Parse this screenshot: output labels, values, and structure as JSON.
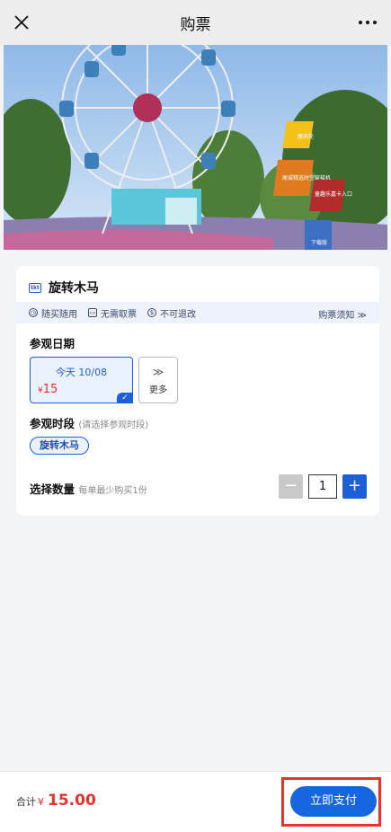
{
  "nav": {
    "title": "购票"
  },
  "banner": {
    "signs": [
      "摩天轮",
      "尾城精选时空穿梭机",
      "童趣乐嘉卡入口",
      "下载版"
    ]
  },
  "ticket": {
    "icon_text": "tkt",
    "name": "旋转木马"
  },
  "policies": [
    {
      "label": "随买随用"
    },
    {
      "label": "无需取票"
    },
    {
      "label": "不可退改"
    }
  ],
  "policy_notice": "购票须知 ≫",
  "visit_date": {
    "title": "参观日期",
    "selected": {
      "label": "今天 10/08",
      "currency": "¥",
      "price": "15"
    },
    "more_label": "更多",
    "more_chevron": "≫"
  },
  "visit_slot": {
    "title": "参观时段",
    "hint": "(请选择参观时段)",
    "chip": "旋转木马"
  },
  "quantity": {
    "title": "选择数量",
    "hint": "每单最少购买1份",
    "value": "1",
    "minus": "−",
    "plus": "+"
  },
  "footer": {
    "total_label": "合计",
    "currency": "¥",
    "amount": "15.00",
    "pay_label": "立即支付"
  }
}
